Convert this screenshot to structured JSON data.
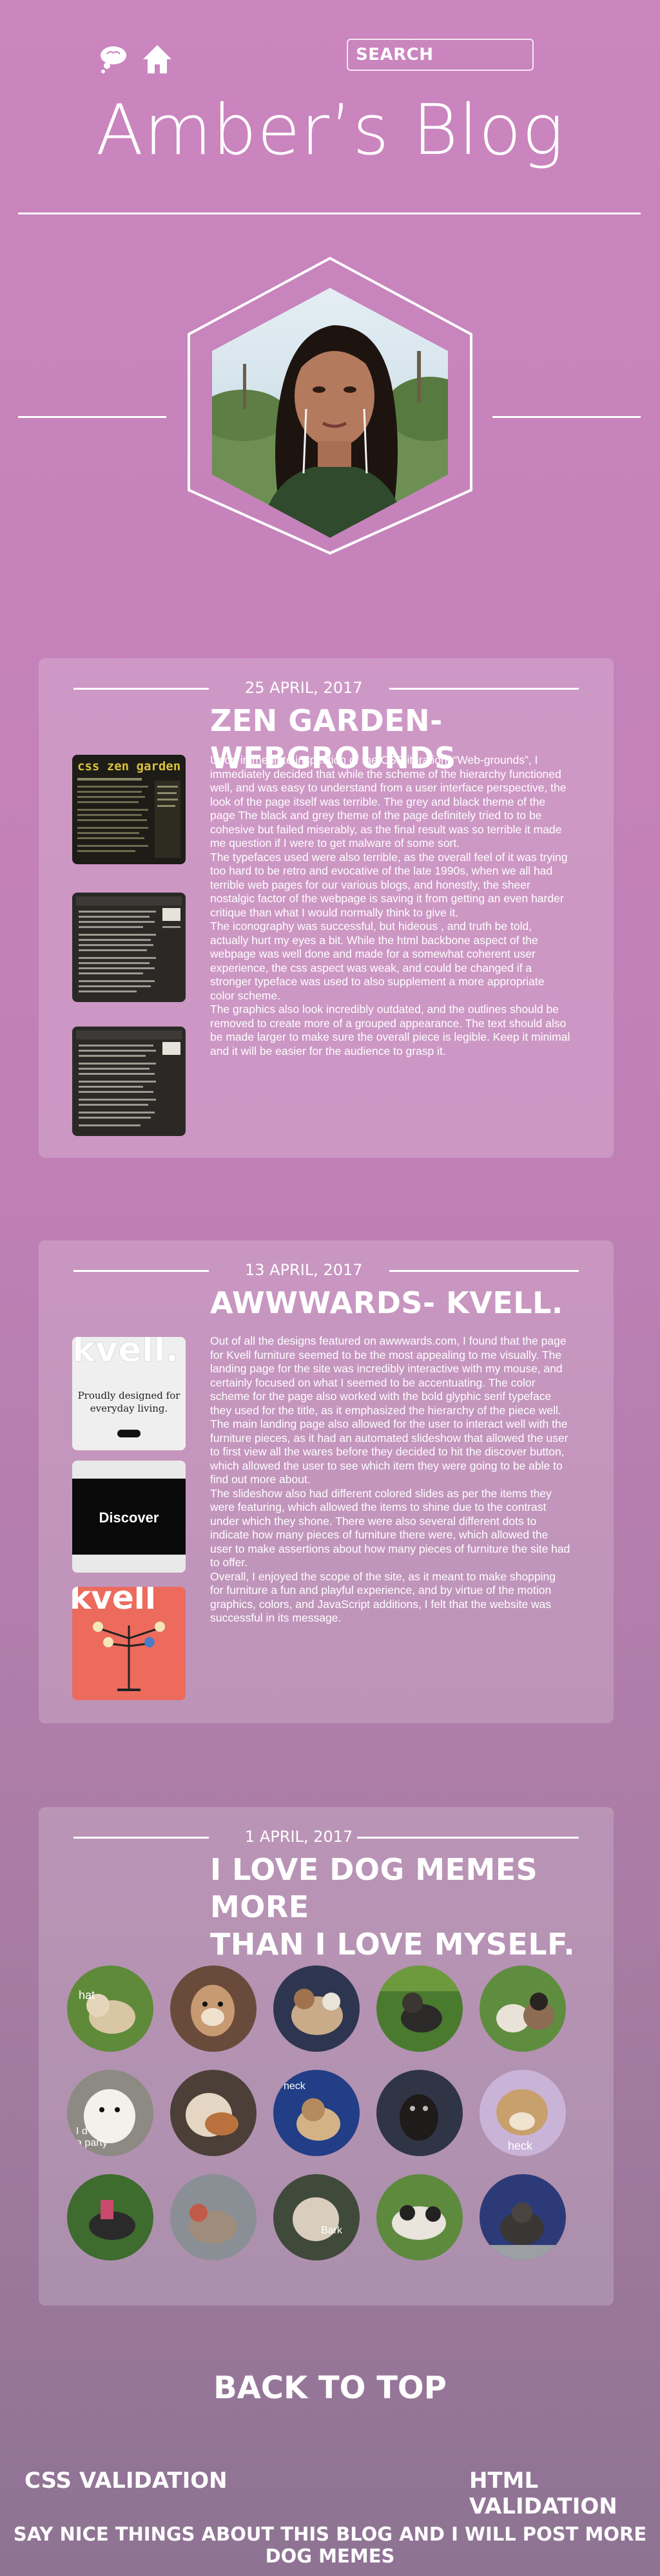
{
  "header": {
    "search_label": "SEARCH",
    "site_title": "Amber’s Blog",
    "icons": [
      "thought-bubble-icon",
      "home-icon"
    ]
  },
  "posts": [
    {
      "date": "25 APRIL, 2017",
      "title": "ZEN GARDEN- WEBGROUNDS",
      "thumb_caption": "css zen garden",
      "paragraphs": [
        " Upon immediate inspection of the CSS iteration, “Web-grounds”, I immediately decided that while the scheme of the hierarchy functioned well, and was easy to understand from a user interface perspective, the look of the page itself was terrible. The grey and black theme of the page The black and grey theme of the page definitely tried to to be cohesive but failed miserably, as the final result was so terrible it made me question if I were to get malware of some sort.",
        "The typefaces used were also terrible, as the overall feel of it was trying too hard to be retro and evocative of the late 1990s, when we all had terrible web pages for our various blogs, and honestly, the sheer nostalgic factor of the webpage is saving it from getting an even harder critique than what I would normally think to give it.",
        "The iconography was successful, but hideous , and truth be told, actually hurt my eyes a bit. While the html backbone aspect of the webpage was well done and made for a somewhat coherent user experience, the css aspect was weak, and could be changed if a stronger typeface was used to also supplement a more appropriate color scheme.",
        "The graphics also look incredibly outdated, and the outlines should be removed to create more of a grouped appearance. The text should also be made larger to make sure the overall piece is legible. Keep it minimal and it will be easier for the audience to grasp it."
      ]
    },
    {
      "date": "13 APRIL, 2017",
      "title": "AWWWARDS- KVELL.",
      "thumb1_brand": "kvell.",
      "thumb1_text_line1": "Proudly designed for",
      "thumb1_text_line2": "everyday living.",
      "thumb2_text": "Discover",
      "thumb3_brand": "kvell",
      "paragraphs": [
        " Out of all the designs featured on awwwards.com, I found that the page for Kvell furniture seemed to be the most appealing to me visually. The landing page for the site was incredibly interactive with my mouse, and certainly focused on what I seemed to be accentuating. The color scheme for the page also worked with the bold glyphic serif typeface they used for the title, as it emphasized the hierarchy of the piece well.",
        "The main landing page also allowed for the user to interact well with the furniture pieces, as it had an automated slideshow that allowed the user to first view all the wares before they decided to hit the discover button, which allowed the user to see which item they were going to be able to find out more about.",
        "The slideshow also had different colored slides as per the items they were featuring, which allowed the items to shine due to the contrast under which they shone. There were also several different dots to indicate how many pieces of furniture there were, which allowed the user to make assertions about how many pieces of furniture the site had to offer.",
        "Overall, I enjoyed the scope of the site, as it meant to make shopping for furniture a fun and playful experience, and by virtue of the motion graphics, colors, and JavaScript additions, I felt that the website was successful in its message."
      ]
    },
    {
      "date": "1 APRIL, 2017",
      "title_line1": "I LOVE DOG MEMES MORE",
      "title_line2": "THAN I LOVE MYSELF.",
      "meme_captions": {
        "m1": "hat",
        "m6": "I d",
        "m6b": "a party",
        "m8": "heck",
        "m10": "heck",
        "m13": "Bark"
      }
    }
  ],
  "footer": {
    "back_to_top": "BACK TO TOP",
    "css_validation": "CSS VALIDATION",
    "html_validation": "HTML VALIDATION",
    "message": "SAY NICE THINGS ABOUT THIS BLOG AND I WILL POST MORE DOG MEMES"
  },
  "colors": {
    "background_top": "#cb85bf",
    "background_bottom": "#8e7393",
    "card": "rgba(255,255,255,0.18)",
    "text": "#ffffff"
  }
}
